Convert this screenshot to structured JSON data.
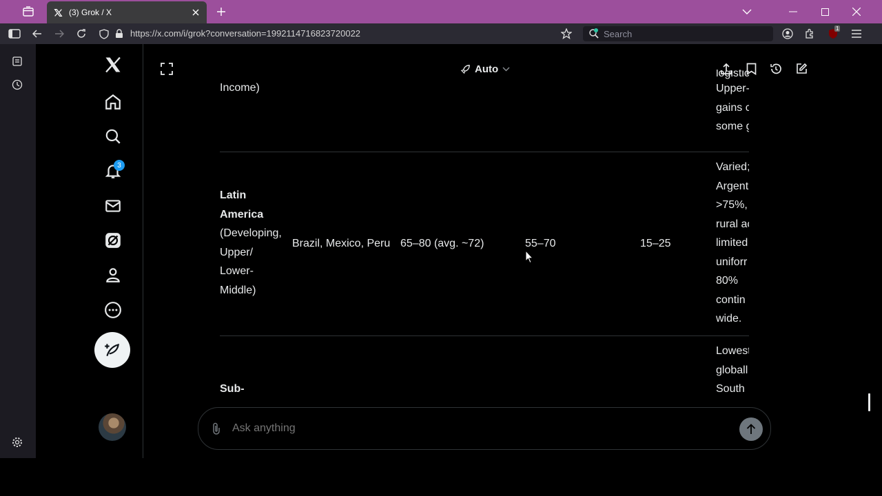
{
  "browser": {
    "tab_title": "(3) Grok / X",
    "url": "https://x.com/i/grok?conversation=1992114716823720022",
    "search_placeholder": "Search",
    "extension_badge": "1"
  },
  "sidebar": {
    "notifications_badge": "3"
  },
  "grok": {
    "mode_label": "Auto",
    "input_placeholder": "Ask anything"
  },
  "table": {
    "prev_row_tail": "Income)",
    "prev_row_notes": [
      "logistic",
      "Upper-",
      "gains c",
      "some g"
    ],
    "latin_america": {
      "region_bold": [
        "Latin",
        "America"
      ],
      "region_rest": [
        "(Developing,",
        "Upper/",
        "Lower-",
        "Middle)"
      ],
      "countries": "Brazil, Mexico, Peru",
      "col3": "65–80 (avg. ~72)",
      "col4": "55–70",
      "col5": "15–25",
      "notes": [
        "Varied;",
        "Argent",
        ">75%,",
        "rural ac",
        "limited",
        "uniforr",
        "80%",
        "contin",
        "wide."
      ]
    },
    "next_row": {
      "region_bold": "Sub-",
      "notes": [
        "Lowest",
        "globall",
        "South"
      ]
    }
  },
  "colors": {
    "titlebar": "#9c4f9c",
    "accent_blue": "#1d9bf0",
    "text": "#e7e9ea",
    "muted": "#71767b"
  }
}
